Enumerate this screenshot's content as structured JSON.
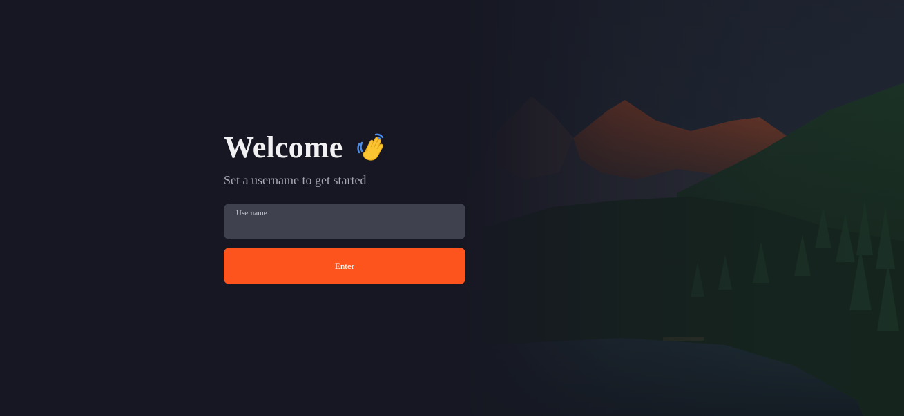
{
  "welcome": {
    "title": "Welcome",
    "wave_icon": "waving-hand-icon",
    "subtitle": "Set a username to get started"
  },
  "form": {
    "username_label": "Username",
    "username_value": "",
    "enter_label": "Enter"
  },
  "background": {
    "image": "mountain-lake-forest-scene"
  },
  "colors": {
    "background": "#161722",
    "field": "#3f414f",
    "accent": "#fc541c",
    "title": "#f1f1f3",
    "subtitle": "#a8a9b4"
  }
}
